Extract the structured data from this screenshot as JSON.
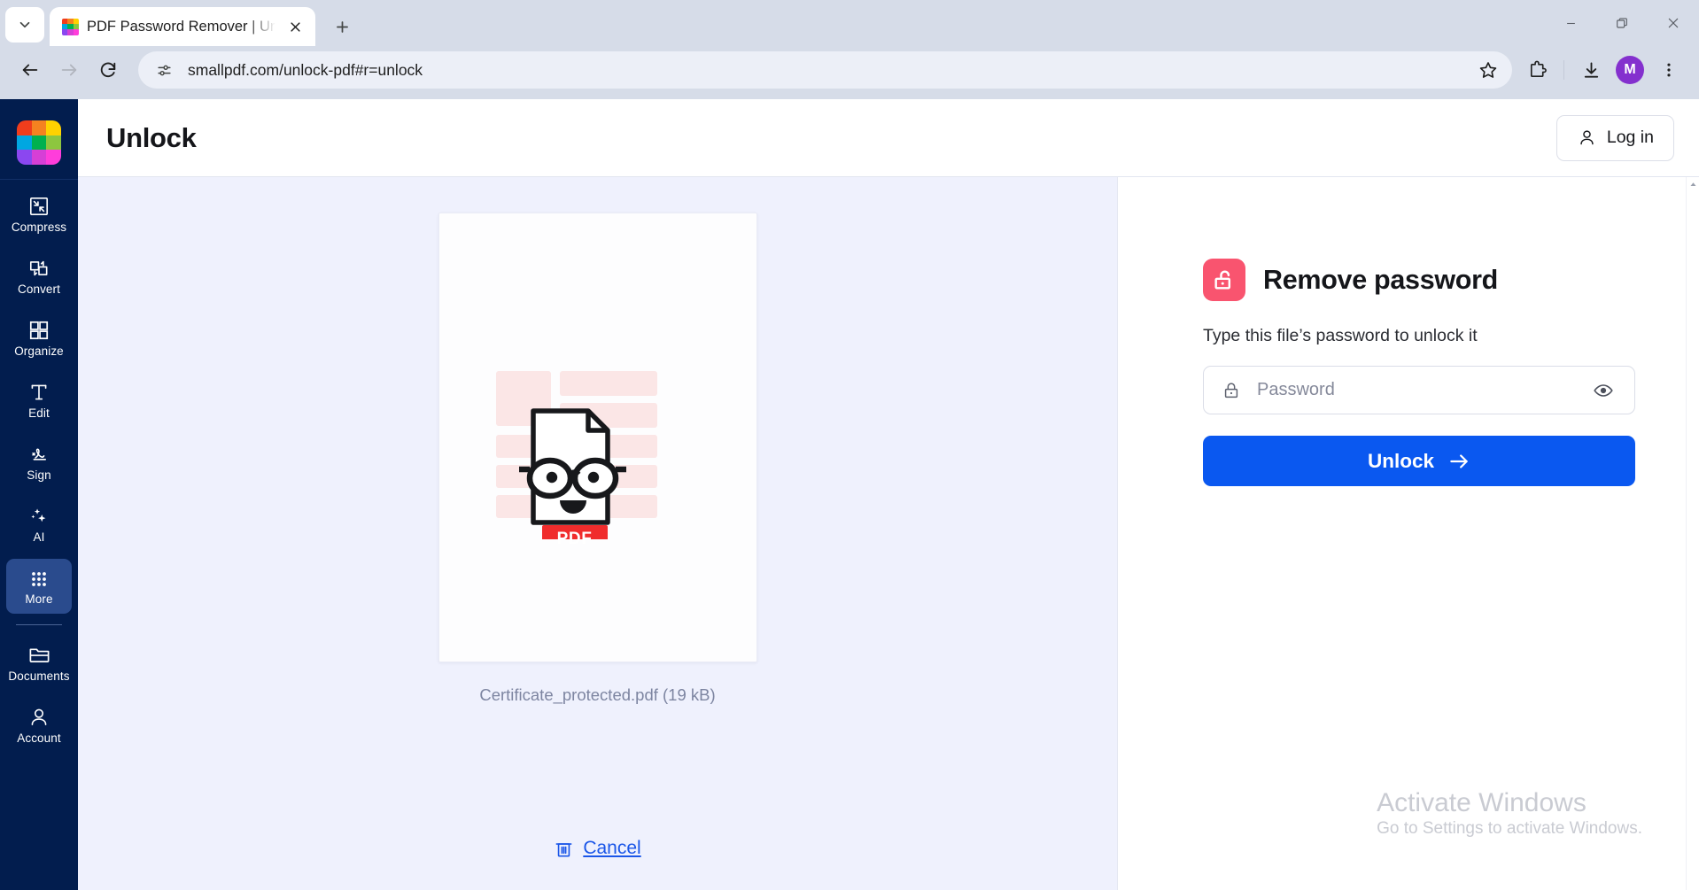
{
  "browser": {
    "tab": {
      "title": "PDF Password Remover | Unlock",
      "favicon_colors": [
        "#f03d1c",
        "#f58220",
        "#ffd200",
        "#00a7e1",
        "#00b14f",
        "#8dc63f",
        "#8b47f0",
        "#d63fd6",
        "#ff3ddb"
      ],
      "close_icon": "close-icon",
      "tab_search_icon": "chevron-down-icon",
      "new_tab_icon": "plus-icon"
    },
    "window_controls": {
      "minimize": "minimize-icon",
      "restore": "restore-icon",
      "close": "close-icon"
    },
    "toolbar": {
      "back_icon": "arrow-left-icon",
      "forward_icon": "arrow-right-icon",
      "reload_icon": "reload-icon",
      "site_info_icon": "site-settings-icon",
      "url": "smallpdf.com/unlock-pdf#r=unlock",
      "bookmark_icon": "star-icon",
      "extensions_icon": "puzzle-piece-icon",
      "downloads_icon": "download-icon",
      "profile_initial": "M",
      "profile_color": "#8430ce",
      "menu_icon": "three-dot-menu-icon"
    }
  },
  "sidebar": {
    "logo": {
      "name": "smallpdf-logo",
      "colors": [
        "#f03d1c",
        "#f58220",
        "#ffd200",
        "#00a7e1",
        "#00b14f",
        "#8dc63f",
        "#8b47f0",
        "#d63fd6",
        "#ff3ddb"
      ]
    },
    "items": [
      {
        "label": "Compress",
        "icon": "compress-icon",
        "active": false
      },
      {
        "label": "Convert",
        "icon": "convert-icon",
        "active": false
      },
      {
        "label": "Organize",
        "icon": "organize-icon",
        "active": false
      },
      {
        "label": "Edit",
        "icon": "text-edit-icon",
        "active": false
      },
      {
        "label": "Sign",
        "icon": "signature-icon",
        "active": false
      },
      {
        "label": "AI",
        "icon": "sparkles-icon",
        "active": false
      },
      {
        "label": "More",
        "icon": "grid-dots-icon",
        "active": true
      }
    ],
    "bottom_items": [
      {
        "label": "Documents",
        "icon": "folder-icon"
      },
      {
        "label": "Account",
        "icon": "person-icon"
      }
    ],
    "background": "#021d4e",
    "active_background": "#2a4b8d"
  },
  "app": {
    "header": {
      "title": "Unlock",
      "login_label": "Log in",
      "login_icon": "person-icon"
    },
    "preview": {
      "file_name": "Certificate_protected.pdf (19 kB)",
      "badge_label": "PDF",
      "badge_color": "#f02c2c",
      "cancel_label": "Cancel",
      "cancel_icon": "trash-icon",
      "cancel_color": "#1a56e8"
    },
    "panel": {
      "icon": "open-padlock-icon",
      "icon_color": "#f9546f",
      "title": "Remove password",
      "subtitle": "Type this file’s password to unlock it",
      "password_field": {
        "icon": "lock-icon",
        "value": "",
        "placeholder": "Password",
        "toggle_icon": "eye-icon"
      },
      "submit_label": "Unlock",
      "submit_icon": "arrow-right-icon",
      "submit_color": "#0a58f0"
    }
  },
  "watermark": {
    "line1": "Activate Windows",
    "line2": "Go to Settings to activate Windows."
  }
}
